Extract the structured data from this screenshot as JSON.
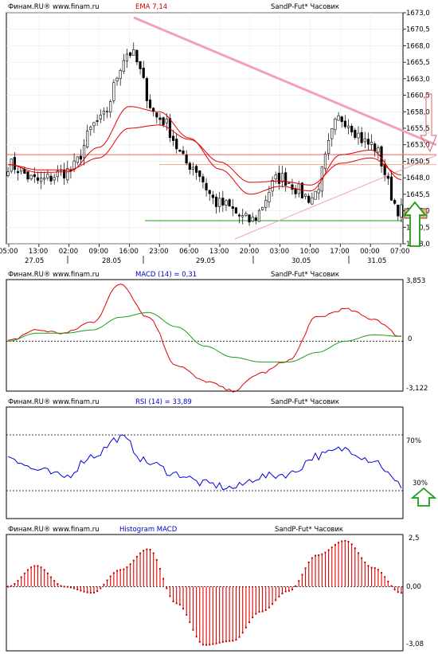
{
  "colors": {
    "up": "#ffffff",
    "down": "#000000",
    "ema": "#e00000",
    "trend": "#f4a0b8",
    "support": "#18a018",
    "resistance": "#f06060",
    "macd": "#e00000",
    "signal": "#18a018",
    "rsi": "#0000dd",
    "hist": "#e00000",
    "arrow_up": "#18a018",
    "arrow_down": "#e06060",
    "price_tag_bg": "#f4b080"
  },
  "panel1": {
    "source": "Финам.RU® www.finam.ru",
    "indicator": "EMA 7,14",
    "symbol": "SandP-Fut* Часовик",
    "price_tag": "1643",
    "y_ticks": [
      "1673,0",
      "1670,5",
      "1668,0",
      "1665,5",
      "1663,0",
      "1660,5",
      "1658,0",
      "1655,5",
      "1653,0",
      "1650,5",
      "1648,0",
      "1645,5",
      "1643,0",
      "1640,5",
      "1638,0"
    ],
    "x_ticks": [
      "05:00",
      "13:00",
      "02:00",
      "09:00",
      "16:00",
      "23:00",
      "06:00",
      "13:00",
      "20:00",
      "03:00",
      "10:00",
      "17:00",
      "00:00",
      "07:00"
    ],
    "dates": [
      "27.05",
      "28.05",
      "29.05",
      "30.05",
      "31.05"
    ]
  },
  "panel2": {
    "source": "Финам.RU® www.finam.ru",
    "indicator": "MACD (14) = 0,31",
    "symbol": "SandP-Fut* Часовик",
    "y_ticks": [
      "3,853",
      "0",
      "-3,122"
    ]
  },
  "panel3": {
    "source": "Финам.RU® www.finam.ru",
    "indicator": "RSI (14) = 33,89",
    "symbol": "SandP-Fut* Часовик",
    "y_ticks": [
      "70%",
      "30%"
    ]
  },
  "panel4": {
    "source": "Финам.RU® www.finam.ru",
    "indicator": "Histogram MACD",
    "symbol": "SandP-Fut* Часовик",
    "y_ticks": [
      "2,5",
      "0,00",
      "-3,08"
    ]
  },
  "chart_data": [
    {
      "type": "candlestick",
      "title": "EMA 7,14",
      "ylim": [
        1638.0,
        1673.0
      ],
      "x": [
        "27.05 05:00",
        "27.05 13:00",
        "28.05 02:00",
        "28.05 09:00",
        "28.05 16:00",
        "28.05 23:00",
        "29.05 06:00",
        "29.05 13:00",
        "29.05 20:00",
        "30.05 03:00",
        "30.05 10:00",
        "30.05 17:00",
        "31.05 00:00",
        "31.05 07:00"
      ],
      "close": [
        1650.0,
        1647.5,
        1649.0,
        1656.5,
        1667.0,
        1657.0,
        1650.0,
        1644.0,
        1641.5,
        1648.0,
        1645.0,
        1657.0,
        1653.0,
        1643.0
      ],
      "ema7": [
        1650.0,
        1648.8,
        1648.9,
        1652.6,
        1658.8,
        1658.0,
        1654.0,
        1649.3,
        1645.5,
        1646.7,
        1646.0,
        1651.5,
        1652.2,
        1647.7
      ],
      "ema14": [
        1650.0,
        1649.2,
        1649.2,
        1651.0,
        1655.5,
        1656.0,
        1653.8,
        1650.4,
        1647.3,
        1647.5,
        1646.9,
        1650.2,
        1651.0,
        1648.4
      ],
      "horizontal_levels": [
        1651.5,
        1650.0,
        1641.5
      ],
      "current_price": 1643.0
    },
    {
      "type": "line",
      "title": "MACD (14) = 0,31",
      "ylim": [
        -3.122,
        3.853
      ],
      "series": [
        {
          "values": [
            0.0,
            0.7,
            0.5,
            1.2,
            3.6,
            1.5,
            -1.5,
            -2.5,
            -3.1,
            -2.0,
            -1.2,
            1.5,
            2.0,
            1.4,
            0.31
          ]
        },
        {
          "values": [
            0.0,
            0.5,
            0.5,
            0.7,
            1.5,
            1.8,
            0.9,
            -0.3,
            -1.0,
            -1.3,
            -1.3,
            -0.7,
            0.0,
            0.4,
            0.3
          ]
        }
      ]
    },
    {
      "type": "line",
      "title": "RSI (14) = 33,89",
      "ylim": [
        10,
        90
      ],
      "levels": [
        70,
        30
      ],
      "series": [
        {
          "values": [
            55,
            45,
            40,
            55,
            68,
            50,
            42,
            35,
            32,
            40,
            42,
            55,
            60,
            52,
            33.89
          ]
        }
      ]
    },
    {
      "type": "bar",
      "title": "Histogram MACD",
      "ylim": [
        -3.08,
        2.5
      ],
      "values": [
        0.0,
        1.0,
        0.0,
        -0.3,
        0.8,
        1.8,
        -0.8,
        -2.8,
        -2.6,
        -1.2,
        -0.2,
        1.5,
        2.2,
        0.9,
        -0.3
      ]
    }
  ]
}
